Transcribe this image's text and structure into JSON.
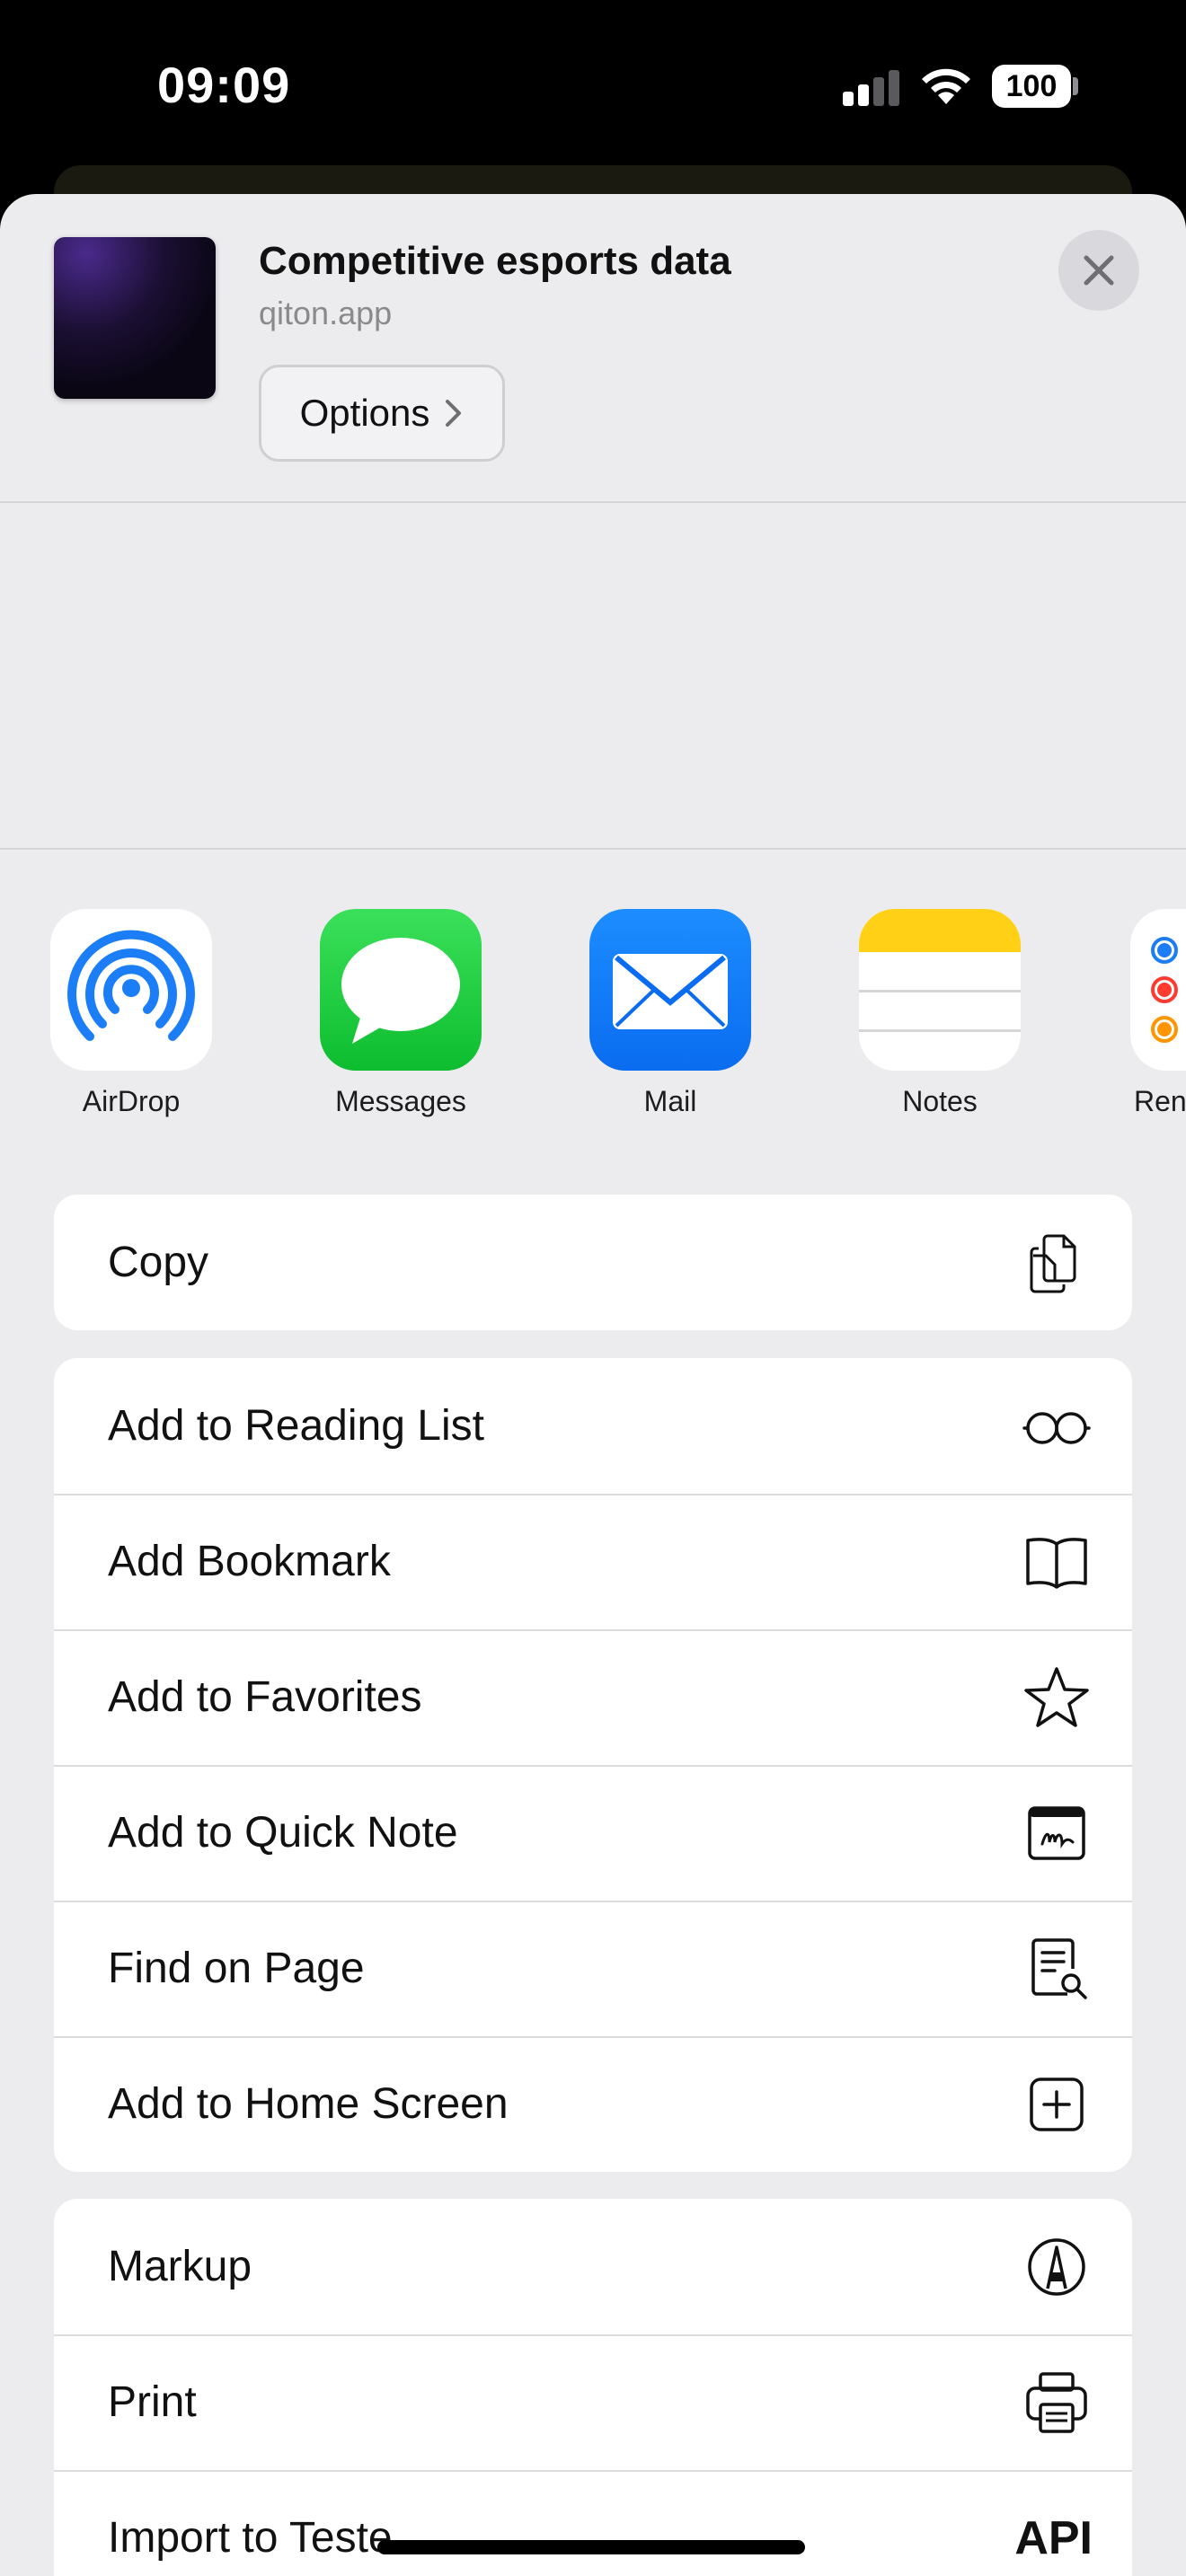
{
  "status_bar": {
    "time": "09:09",
    "battery": "100",
    "icons": [
      "cellular-signal-icon",
      "wifi-icon",
      "battery-icon"
    ]
  },
  "share_sheet": {
    "title": "Competitive esports data",
    "subtitle": "qiton.app",
    "options_label": "Options",
    "icons": [
      "chevron-right-icon",
      "close-icon"
    ]
  },
  "apps": [
    {
      "label": "AirDrop",
      "icon": "airdrop-icon"
    },
    {
      "label": "Messages",
      "icon": "messages-icon"
    },
    {
      "label": "Mail",
      "icon": "mail-icon"
    },
    {
      "label": "Notes",
      "icon": "notes-icon"
    },
    {
      "label": "Ren",
      "icon": "reminders-icon"
    }
  ],
  "actions": {
    "group1": [
      {
        "label": "Copy",
        "icon": "copy-icon"
      }
    ],
    "group2": [
      {
        "label": "Add to Reading List",
        "icon": "glasses-icon"
      },
      {
        "label": "Add Bookmark",
        "icon": "book-icon"
      },
      {
        "label": "Add to Favorites",
        "icon": "star-icon"
      },
      {
        "label": "Add to Quick Note",
        "icon": "quick-note-icon"
      },
      {
        "label": "Find on Page",
        "icon": "find-on-page-icon"
      },
      {
        "label": "Add to Home Screen",
        "icon": "add-square-icon"
      }
    ],
    "group3": [
      {
        "label": "Markup",
        "icon": "markup-icon"
      },
      {
        "label": "Print",
        "icon": "printer-icon"
      },
      {
        "label": "Import to Teste",
        "icon": "api-text-icon",
        "icon_text": "API"
      }
    ]
  },
  "colors": {
    "sheet_background": "#ececee",
    "row_background": "#ffffff",
    "accent_blue": "#0a6cf0",
    "messages_green": "#0dbd2f",
    "notes_yellow": "#ffd016"
  }
}
